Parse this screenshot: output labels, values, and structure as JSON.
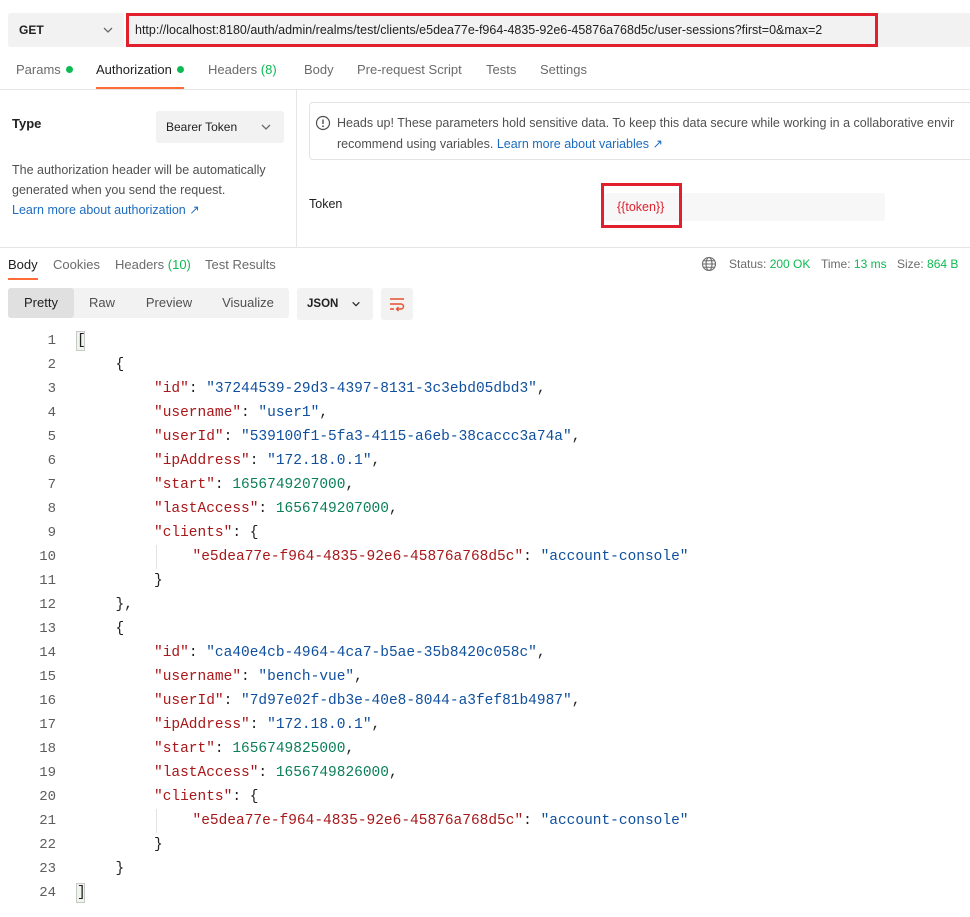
{
  "request": {
    "method": "GET",
    "url": "http://localhost:8180/auth/admin/realms/test/clients/e5dea77e-f964-4835-92e6-45876a768d5c/user-sessions?first=0&max=2"
  },
  "request_tabs": [
    {
      "label": "Params",
      "dot": true
    },
    {
      "label": "Authorization",
      "dot": true
    },
    {
      "label": "Headers",
      "count": "(8)"
    },
    {
      "label": "Body"
    },
    {
      "label": "Pre-request Script"
    },
    {
      "label": "Tests"
    },
    {
      "label": "Settings"
    }
  ],
  "auth": {
    "type_label": "Type",
    "type_value": "Bearer Token",
    "help_text": "The authorization header will be automatically generated when you send the request.",
    "help_link": "Learn more about authorization ↗",
    "alert_line1": "Heads up! These parameters hold sensitive data. To keep this data secure while working in a collaborative envir",
    "alert_line2": "recommend using variables.",
    "alert_link": "Learn more about variables ↗",
    "token_label": "Token",
    "token_value": "{{token}}"
  },
  "response_tabs": [
    {
      "label": "Body"
    },
    {
      "label": "Cookies"
    },
    {
      "label": "Headers",
      "count": "(10)"
    },
    {
      "label": "Test Results"
    }
  ],
  "status": {
    "status_label": "Status:",
    "status_value": "200 OK",
    "time_label": "Time:",
    "time_value": "13 ms",
    "size_label": "Size:",
    "size_value": "864 B"
  },
  "view_modes": [
    "Pretty",
    "Raw",
    "Preview",
    "Visualize"
  ],
  "format": "JSON",
  "sessions": [
    {
      "id": "37244539-29d3-4397-8131-3c3ebd05dbd3",
      "username": "user1",
      "userId": "539100f1-5fa3-4115-a6eb-38caccc3a74a",
      "ipAddress": "172.18.0.1",
      "start": 1656749207000,
      "lastAccess": 1656749207000,
      "clients": {
        "e5dea77e-f964-4835-92e6-45876a768d5c": "account-console"
      }
    },
    {
      "id": "ca40e4cb-4964-4ca7-b5ae-35b8420c058c",
      "username": "bench-vue",
      "userId": "7d97e02f-db3e-40e8-8044-a3fef81b4987",
      "ipAddress": "172.18.0.1",
      "start": 1656749825000,
      "lastAccess": 1656749826000,
      "clients": {
        "e5dea77e-f964-4835-92e6-45876a768d5c": "account-console"
      }
    }
  ]
}
